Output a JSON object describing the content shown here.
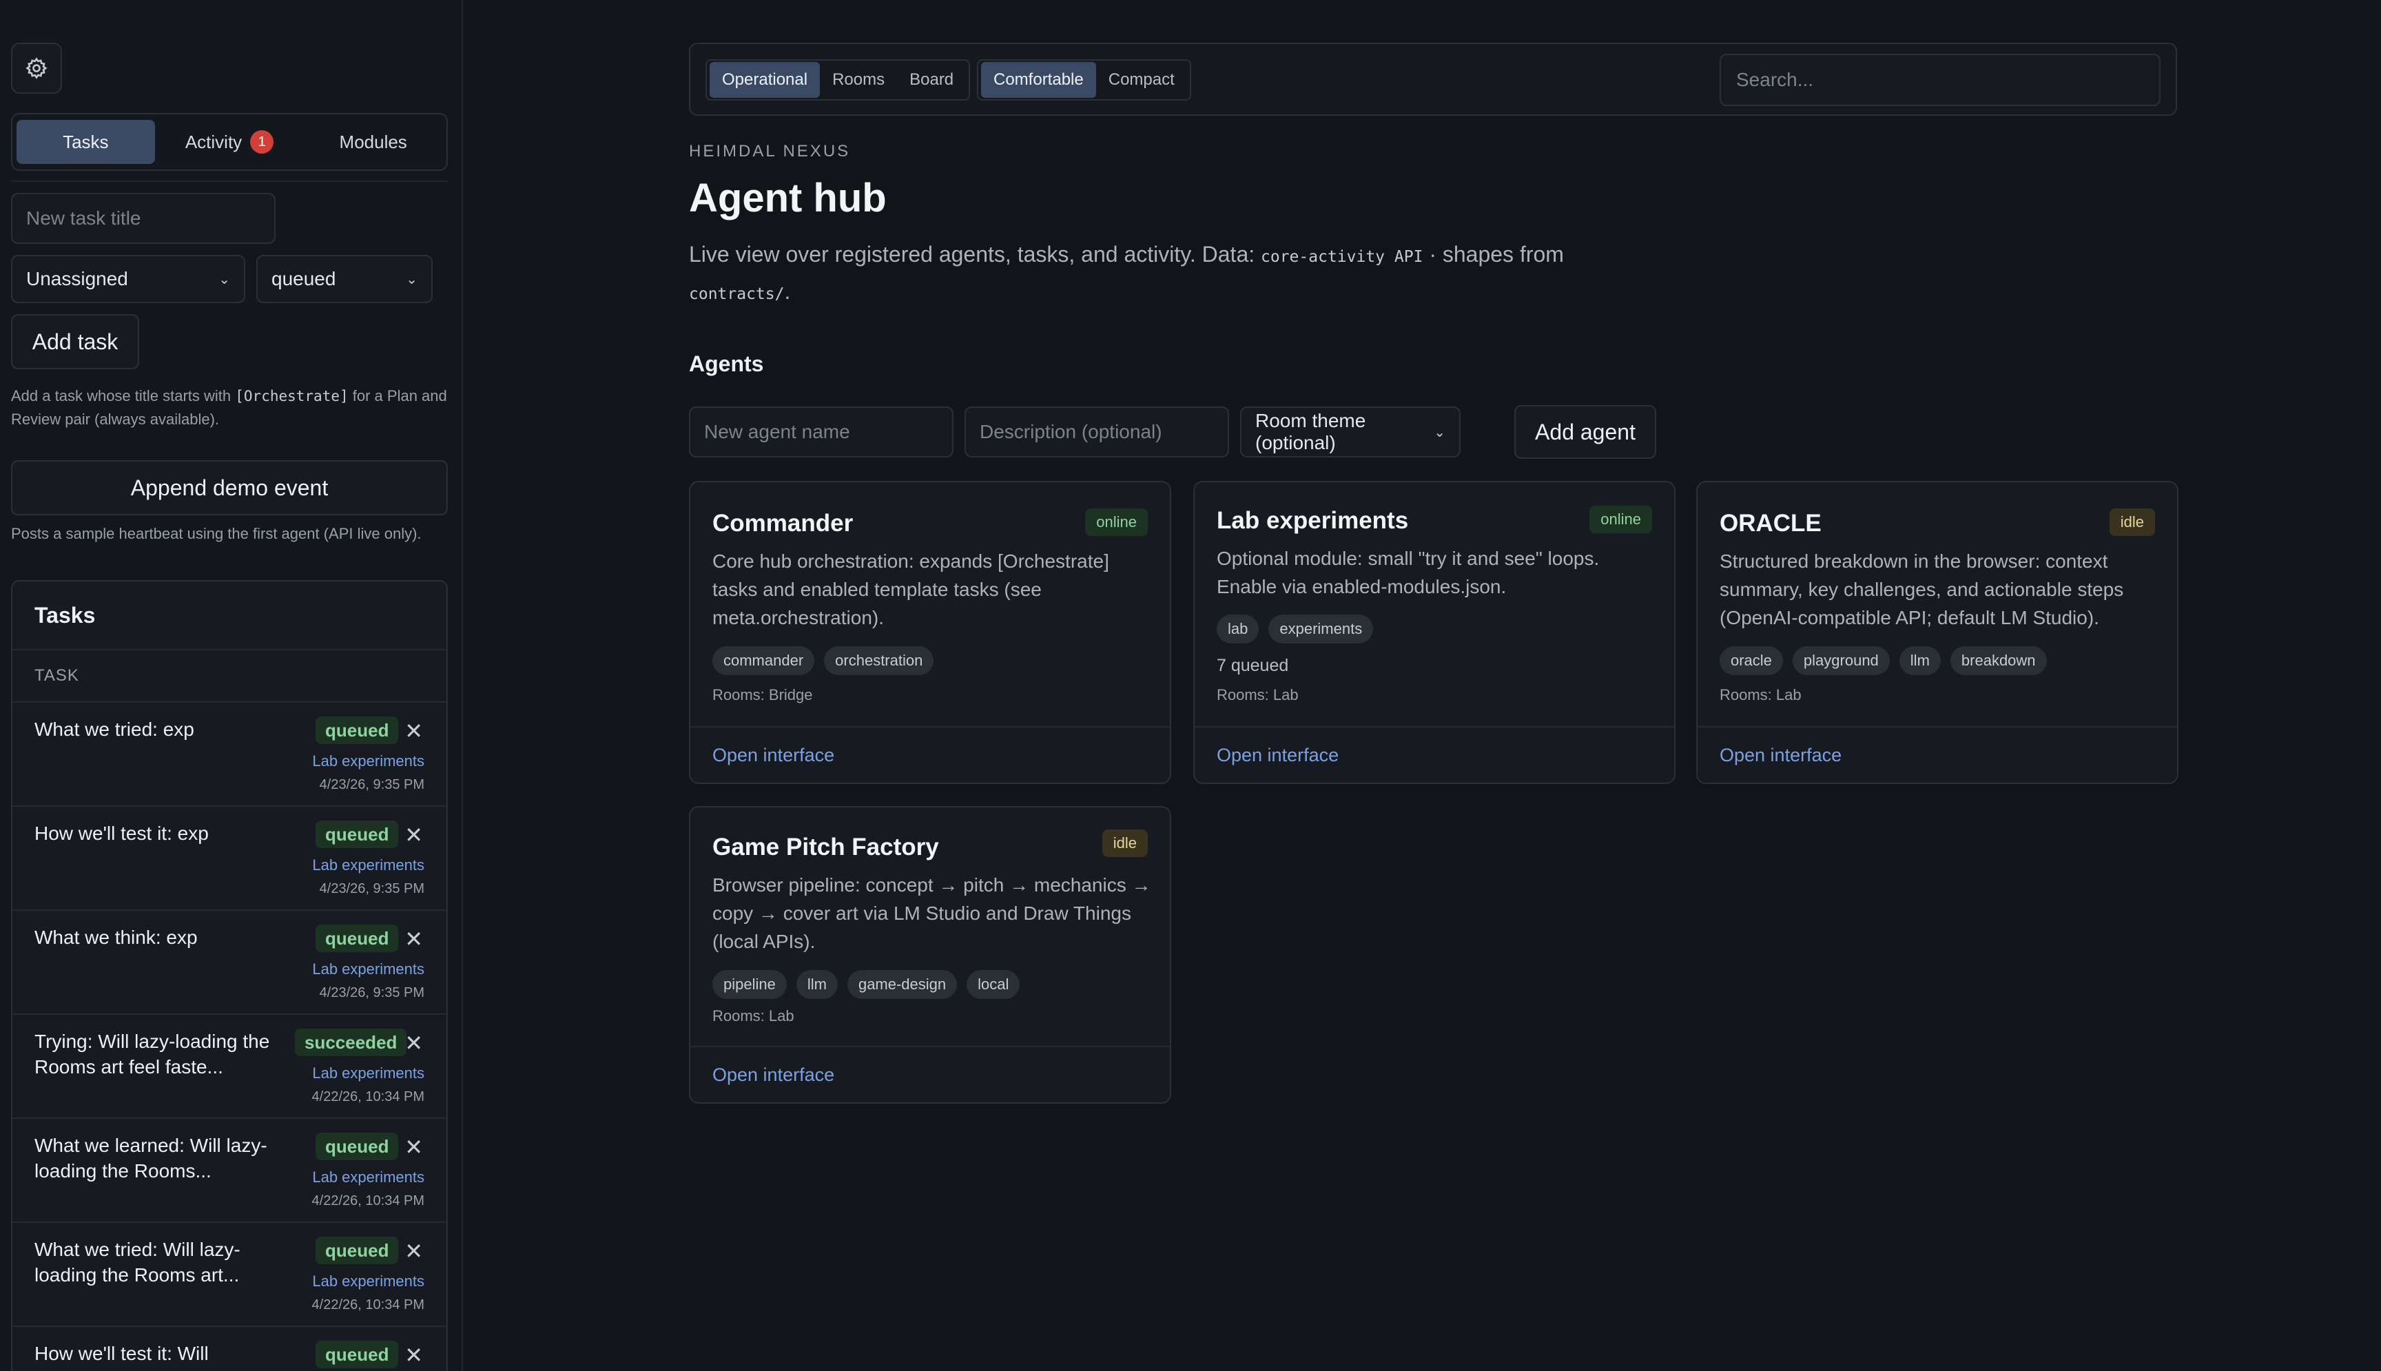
{
  "sidebar": {
    "tabs": [
      {
        "label": "Tasks",
        "active": true
      },
      {
        "label": "Activity",
        "badge": "1"
      },
      {
        "label": "Modules"
      }
    ],
    "new_task_placeholder": "New task title",
    "assignee_value": "Unassigned",
    "status_value": "queued",
    "add_task_label": "Add task",
    "help_prefix": "Add a task whose title starts with",
    "help_code": "[Orchestrate]",
    "help_suffix": "for a Plan and Review pair (always available).",
    "append_demo_label": "Append demo event",
    "append_demo_help": "Posts a sample heartbeat using the first agent (API live only).",
    "tasks_title": "Tasks",
    "tasks_column": "TASK",
    "tasks": [
      {
        "title": "What we tried: exp",
        "status": "queued",
        "agent": "Lab experiments",
        "date": "4/23/26, 9:35 PM"
      },
      {
        "title": "How we'll test it: exp",
        "status": "queued",
        "agent": "Lab experiments",
        "date": "4/23/26, 9:35 PM"
      },
      {
        "title": "What we think: exp",
        "status": "queued",
        "agent": "Lab experiments",
        "date": "4/23/26, 9:35 PM"
      },
      {
        "title": "Trying: Will lazy-loading the Rooms art feel faste...",
        "status": "succeeded",
        "agent": "Lab experiments",
        "date": "4/22/26, 10:34 PM"
      },
      {
        "title": "What we learned: Will lazy-loading the Rooms...",
        "status": "queued",
        "agent": "Lab experiments",
        "date": "4/22/26, 10:34 PM"
      },
      {
        "title": "What we tried: Will lazy-loading the Rooms art...",
        "status": "queued",
        "agent": "Lab experiments",
        "date": "4/22/26, 10:34 PM"
      },
      {
        "title": "How we'll test it: Will",
        "status": "queued",
        "agent": "",
        "date": ""
      }
    ]
  },
  "toolbar": {
    "views": [
      "Operational",
      "Rooms",
      "Board"
    ],
    "active_view": "Operational",
    "density": [
      "Comfortable",
      "Compact"
    ],
    "active_density": "Comfortable",
    "search_placeholder": "Search..."
  },
  "header": {
    "eyebrow": "HEIMDAL NEXUS",
    "title": "Agent hub",
    "lede_prefix": "Live view over registered agents, tasks, and activity. Data:",
    "lede_code1": "core-activity API",
    "lede_mid": "· shapes from",
    "lede_code2": "contracts/",
    "lede_suffix": "."
  },
  "agents_section": {
    "title": "Agents",
    "name_placeholder": "New agent name",
    "desc_placeholder": "Description (optional)",
    "theme_value": "Room theme (optional)",
    "add_label": "Add agent"
  },
  "agents": [
    {
      "name": "Commander",
      "status": "online",
      "description": "Core hub orchestration: expands [Orchestrate] tasks and enabled template tasks (see meta.orchestration).",
      "tags": [
        "commander",
        "orchestration"
      ],
      "queued": "",
      "rooms": "Rooms: Bridge",
      "link": "Open interface"
    },
    {
      "name": "Lab experiments",
      "status": "online",
      "description": "Optional module: small \"try it and see\" loops. Enable via enabled-modules.json.",
      "tags": [
        "lab",
        "experiments"
      ],
      "queued": "7 queued",
      "rooms": "Rooms: Lab",
      "link": "Open interface"
    },
    {
      "name": "ORACLE",
      "status": "idle",
      "description": "Structured breakdown in the browser: context summary, key challenges, and actionable steps (OpenAI-compatible API; default LM Studio).",
      "tags": [
        "oracle",
        "playground",
        "llm",
        "breakdown"
      ],
      "queued": "",
      "rooms": "Rooms: Lab",
      "link": "Open interface"
    },
    {
      "name": "Game Pitch Factory",
      "status": "idle",
      "description": "Browser pipeline: concept → pitch → mechanics → copy → cover art via LM Studio and Draw Things (local APIs).",
      "tags": [
        "pipeline",
        "llm",
        "game-design",
        "local"
      ],
      "queued": "",
      "rooms": "Rooms: Lab",
      "link": "Open interface"
    }
  ]
}
